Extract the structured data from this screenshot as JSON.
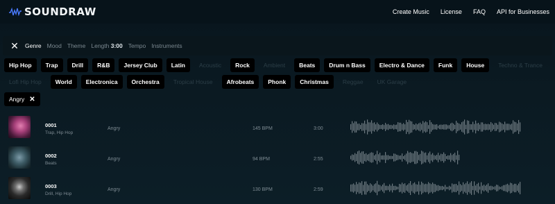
{
  "header": {
    "logo": "SOUNDRAW",
    "nav": [
      "Create Music",
      "License",
      "FAQ",
      "API for Businesses"
    ]
  },
  "filters": {
    "tabs": [
      "Genre",
      "Mood",
      "Theme"
    ],
    "length_label": "Length",
    "length_value": "3:00",
    "tempo": "Tempo",
    "instruments": "Instruments"
  },
  "genres_row1": [
    {
      "label": "Hip Hop",
      "enabled": true
    },
    {
      "label": "Trap",
      "enabled": true
    },
    {
      "label": "Drill",
      "enabled": true
    },
    {
      "label": "R&B",
      "enabled": true
    },
    {
      "label": "Jersey Club",
      "enabled": true
    },
    {
      "label": "Latin",
      "enabled": true
    },
    {
      "label": "Acoustic",
      "enabled": false
    },
    {
      "label": "Rock",
      "enabled": true
    },
    {
      "label": "Ambient",
      "enabled": false
    },
    {
      "label": "Beats",
      "enabled": true
    },
    {
      "label": "Drum n Bass",
      "enabled": true
    },
    {
      "label": "Electro & Dance",
      "enabled": true
    },
    {
      "label": "Funk",
      "enabled": true
    },
    {
      "label": "House",
      "enabled": true
    },
    {
      "label": "Techno & Trance",
      "enabled": false
    }
  ],
  "genres_row2": [
    {
      "label": "Lofi Hip Hop",
      "enabled": false
    },
    {
      "label": "World",
      "enabled": true
    },
    {
      "label": "Electronica",
      "enabled": true
    },
    {
      "label": "Orchestra",
      "enabled": true
    },
    {
      "label": "Tropical House",
      "enabled": false
    },
    {
      "label": "Afrobeats",
      "enabled": true
    },
    {
      "label": "Phonk",
      "enabled": true
    },
    {
      "label": "Christmas",
      "enabled": true
    },
    {
      "label": "Reggae",
      "enabled": false
    },
    {
      "label": "UK Garage",
      "enabled": false
    }
  ],
  "selected_filter": "Angry",
  "tracks": [
    {
      "num": "0001",
      "genre": "Trap, Hip Hop",
      "mood": "Angry",
      "bpm": "145 BPM",
      "duration": "3:00"
    },
    {
      "num": "0002",
      "genre": "Beats",
      "mood": "Angry",
      "bpm": "94 BPM",
      "duration": "2:55"
    },
    {
      "num": "0003",
      "genre": "Drill, Hip Hop",
      "mood": "Angry",
      "bpm": "130 BPM",
      "duration": "2:59"
    }
  ],
  "colors": {
    "background": "#0b1a22",
    "chip_bg": "#000000",
    "muted_text": "#7f8c94",
    "logo_accent": "#4a7bff"
  }
}
